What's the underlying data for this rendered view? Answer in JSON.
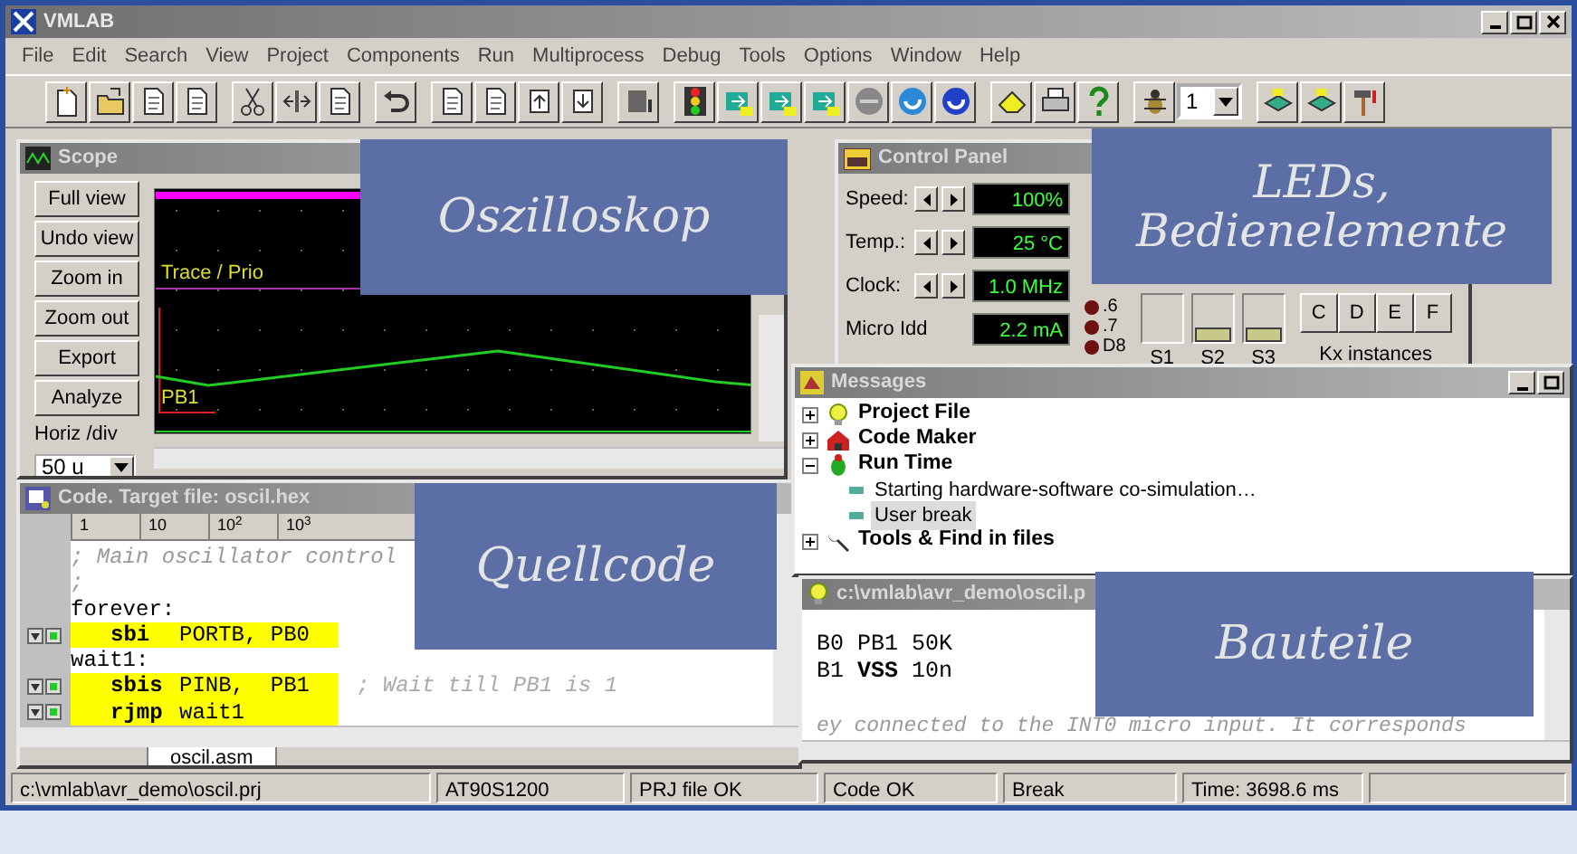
{
  "window": {
    "title": "VMLAB"
  },
  "menu": [
    "File",
    "Edit",
    "Search",
    "View",
    "Project",
    "Components",
    "Run",
    "Multiprocess",
    "Debug",
    "Tools",
    "Options",
    "Window",
    "Help"
  ],
  "toolbar": {
    "thread": "1"
  },
  "scope": {
    "title": "Scope",
    "buttons": [
      "Full view",
      "Undo view",
      "Zoom in",
      "Zoom out",
      "Export",
      "Analyze"
    ],
    "horiz_label": "Horiz /div",
    "horiz_value": "50 u",
    "traces": [
      "Trace / Prio",
      "PB1"
    ]
  },
  "control_panel": {
    "title": "Control Panel",
    "readouts": [
      {
        "label": "Speed:",
        "value": "100%",
        "adjustable": true
      },
      {
        "label": "Temp.:",
        "value": "25 °C",
        "adjustable": true
      },
      {
        "label": "Clock:",
        "value": "1.0 MHz",
        "adjustable": true
      },
      {
        "label": "Micro Idd",
        "value": "2.2 mA",
        "adjustable": false
      }
    ],
    "leds_bottom": [
      {
        "label": ".6",
        "color": "#6e1010"
      },
      {
        "label": ".7",
        "color": "#6e1010"
      },
      {
        "label": "D8",
        "color": "#6e1010"
      }
    ],
    "sliders": [
      {
        "label": "S1"
      },
      {
        "label": "S2",
        "level": 0
      },
      {
        "label": "S3",
        "level": 0
      }
    ],
    "keys": [
      "C",
      "D",
      "E",
      "F"
    ],
    "keypad_caption": "Kx instances"
  },
  "messages": {
    "title": "Messages",
    "tree": [
      {
        "label": "Project File",
        "kind": "bulb",
        "expanded": false
      },
      {
        "label": "Code Maker",
        "kind": "house",
        "expanded": false
      },
      {
        "label": "Run Time",
        "kind": "bug",
        "expanded": true,
        "children": [
          {
            "label": "Starting hardware-software co-simulation…",
            "selected": false
          },
          {
            "label": "User break",
            "selected": true
          }
        ]
      },
      {
        "label": "Tools & Find in files",
        "kind": "wrench",
        "expanded": false
      }
    ]
  },
  "code": {
    "title": "Code. Target file: oscil.hex",
    "ruler": [
      "1",
      "10",
      "10$^{2}$",
      "10$^{3}$"
    ],
    "lines": [
      {
        "kind": "comment",
        "text": "; Main oscillator control"
      },
      {
        "kind": "comment",
        "text": ";"
      },
      {
        "kind": "label",
        "text": "forever:"
      },
      {
        "kind": "instr",
        "mnemonic": "sbi",
        "operands": "PORTB, PB0",
        "executed": true
      },
      {
        "kind": "label",
        "text": "wait1:"
      },
      {
        "kind": "instr",
        "mnemonic": "sbis",
        "operands": "PINB,  PB1",
        "comment": "; Wait till PB1 is 1",
        "executed": true
      },
      {
        "kind": "instr",
        "mnemonic": "rjmp",
        "operands": "wait1",
        "executed": true
      }
    ],
    "tab": "oscil.asm"
  },
  "parts": {
    "title": "c:\\vmlab\\avr_demo\\oscil.p",
    "lines": [
      {
        "kind": "code",
        "text": "B0 PB1 50K"
      },
      {
        "kind": "code",
        "text": "B1 **VSS** 10n"
      },
      {
        "kind": "comment",
        "text": "ey connected to the INT0 micro input. It corresponds"
      }
    ]
  },
  "status_bar": [
    "c:\\vmlab\\avr_demo\\oscil.prj",
    "AT90S1200",
    "PRJ file OK",
    "Code OK",
    "Break",
    "Time:  3698.6 ms"
  ],
  "annotations": [
    "Oszilloskop",
    "LEDs,\nBedienelemente",
    "Quellcode",
    "Bauteile"
  ]
}
